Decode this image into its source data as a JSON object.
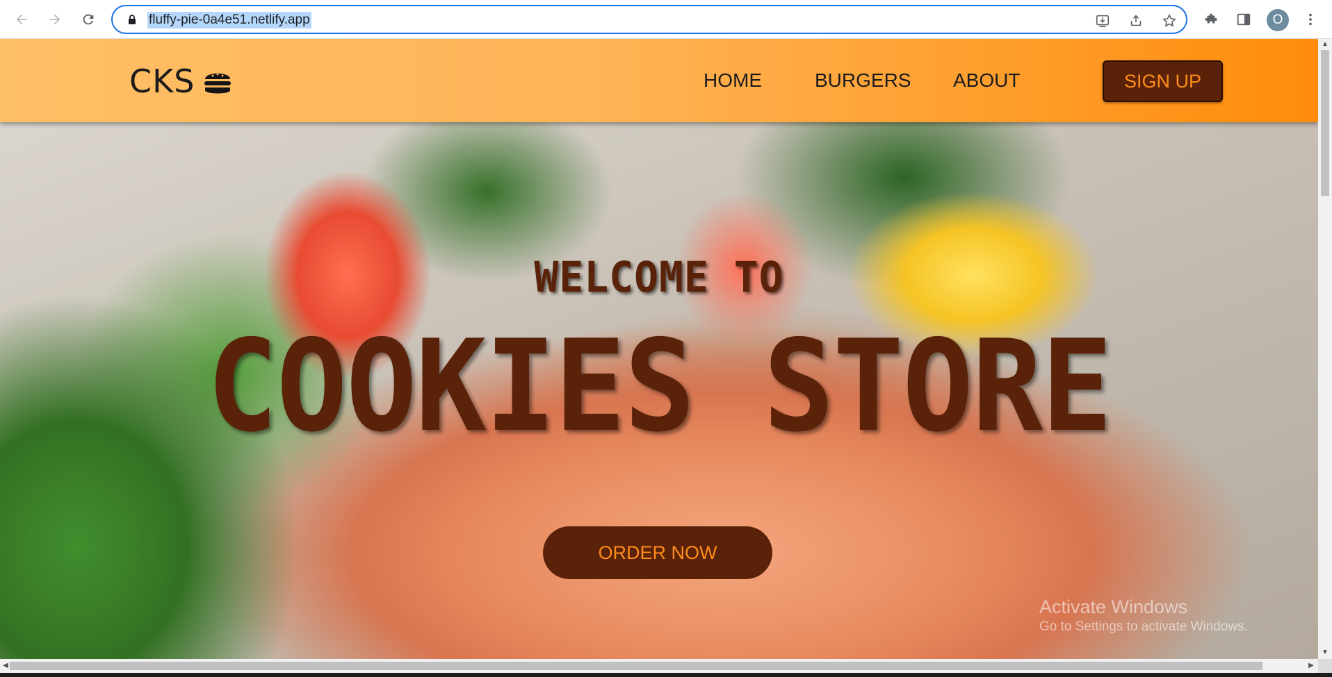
{
  "browser": {
    "url": "fluffy-pie-0a4e51.netlify.app",
    "profile_initial": "O",
    "icons": [
      "back-icon",
      "forward-icon",
      "reload-icon",
      "lock-icon",
      "install-icon",
      "share-icon",
      "bookmark-star-icon",
      "extensions-icon",
      "side-panel-icon",
      "menu-kebab-icon"
    ]
  },
  "site": {
    "logo": "CKS",
    "logo_icon": "burger-icon",
    "nav": [
      {
        "label": "HOME"
      },
      {
        "label": "BURGERS"
      },
      {
        "label": "ABOUT"
      }
    ],
    "signup_label": "SIGN UP",
    "colors": {
      "header_start": "#ffbf66",
      "header_end": "#ff8c0a",
      "brown": "#5a2208",
      "button_text": "#ff8c1a"
    }
  },
  "hero": {
    "welcome": "WELCOME TO",
    "title": "COOKIES STORE",
    "cta_label": "ORDER NOW"
  },
  "windows_watermark": {
    "title": "Activate Windows",
    "subtitle": "Go to Settings to activate Windows."
  }
}
